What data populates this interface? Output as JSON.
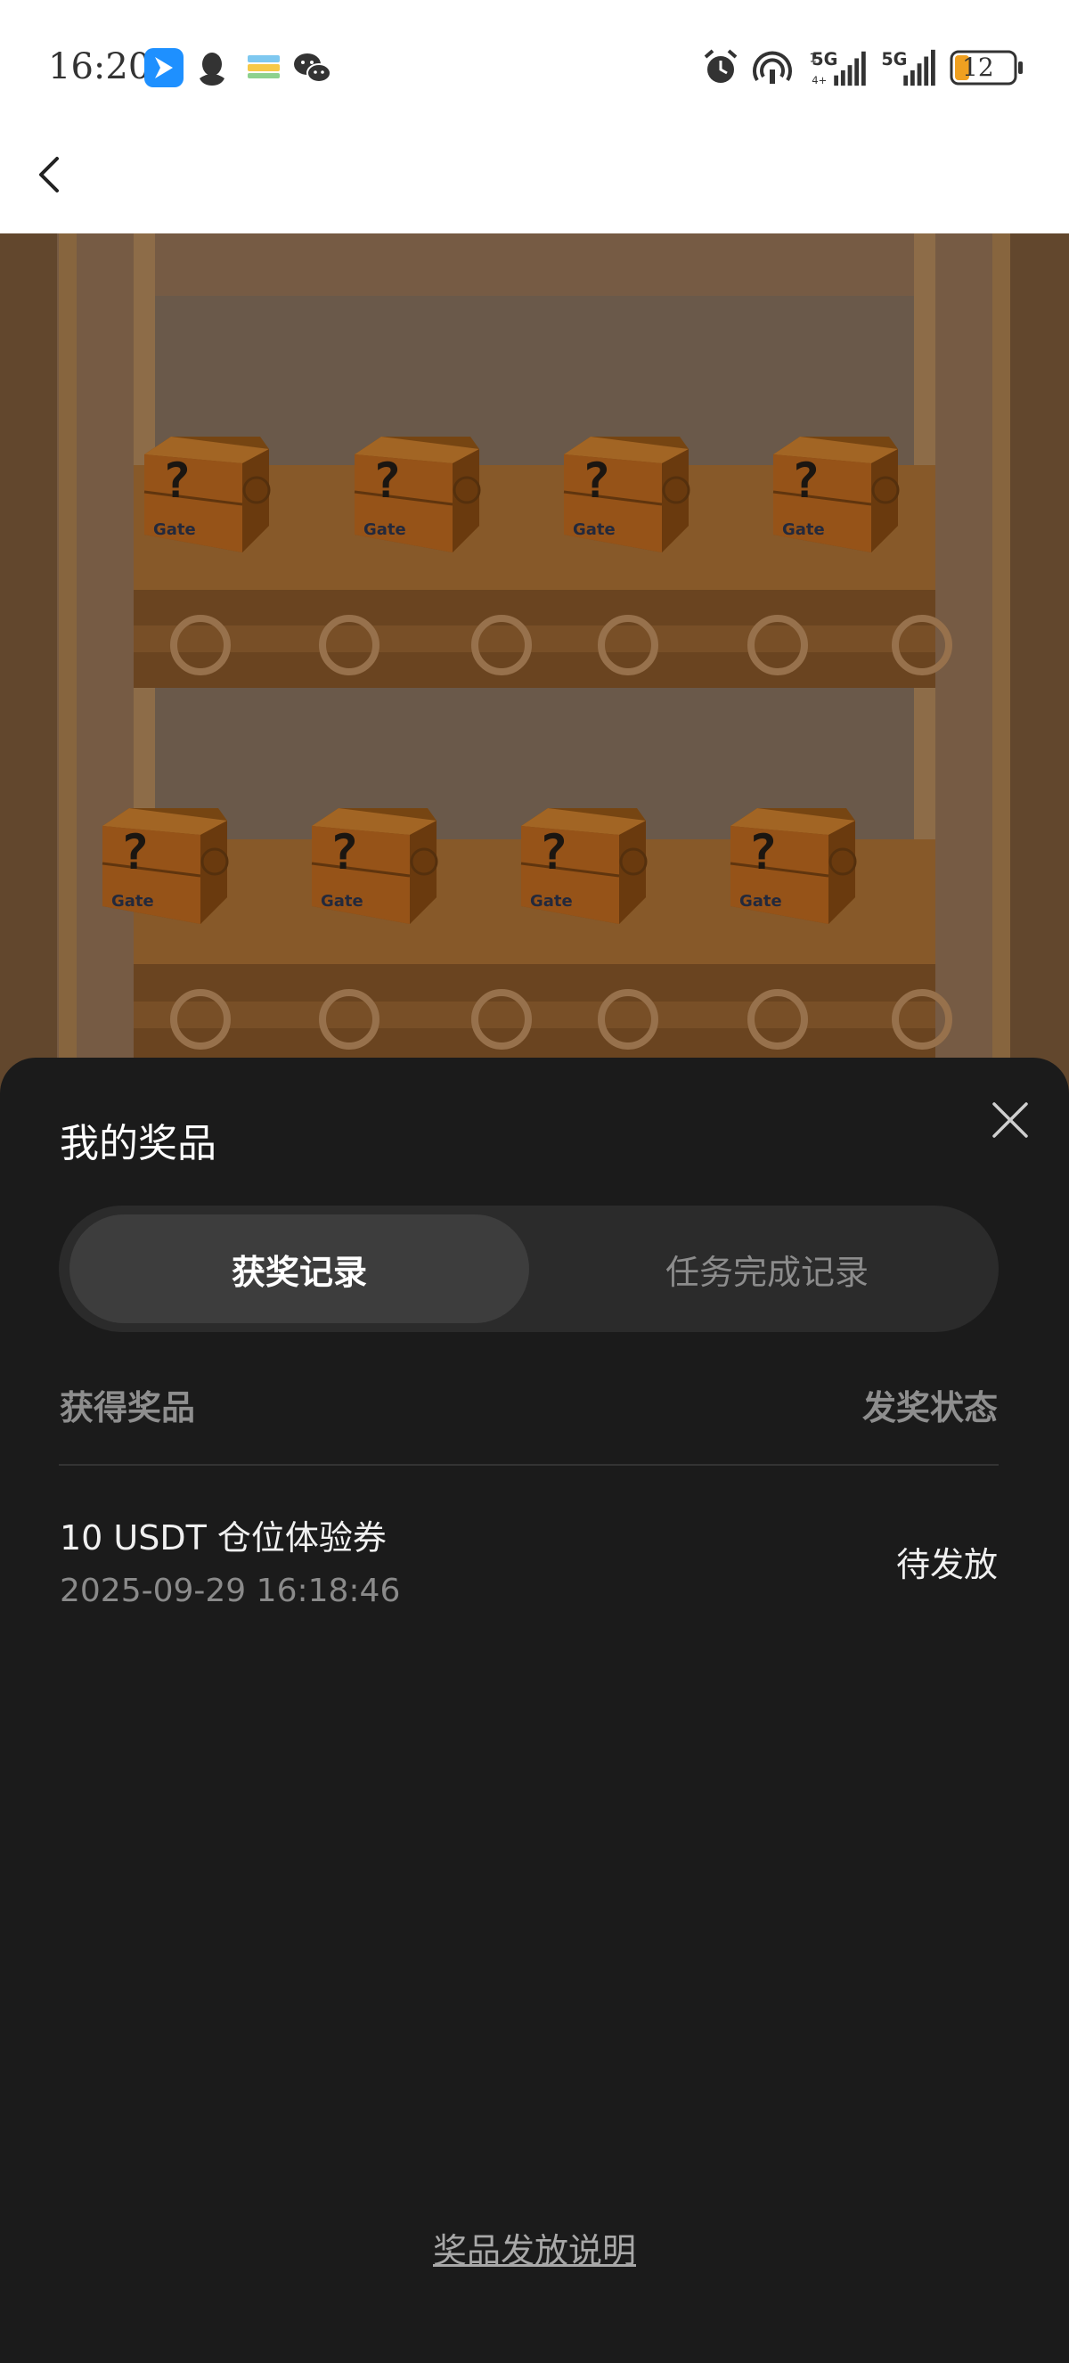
{
  "status_bar": {
    "time": "16:20",
    "battery": "12",
    "signal_labels": [
      "5G",
      "5G"
    ],
    "icons": [
      "feishu-icon",
      "qq-icon",
      "wallet-icon",
      "wechat-icon",
      "alarm-icon",
      "hotspot-icon",
      "signal-icon",
      "signal-icon",
      "battery-icon"
    ]
  },
  "nav": {
    "back_icon": "back-chevron-icon"
  },
  "scene": {
    "box_label": "Gate",
    "box_mark": "?"
  },
  "sheet": {
    "title": "我的奖品",
    "close_icon": "close-icon",
    "tabs": [
      {
        "label": "获奖记录",
        "active": true
      },
      {
        "label": "任务完成记录",
        "active": false
      }
    ],
    "columns": {
      "prize": "获得奖品",
      "status": "发奖状态"
    },
    "records": [
      {
        "name": "10 USDT 仓位体验券",
        "time": "2025-09-29 16:18:46",
        "status": "待发放"
      }
    ],
    "footer_link": "奖品发放说明"
  },
  "colors": {
    "sheet_bg": "#1b1b1b",
    "tab_track": "#2b2b2b",
    "tab_active": "#3d3d3d",
    "box_orange": "#c96a12"
  }
}
